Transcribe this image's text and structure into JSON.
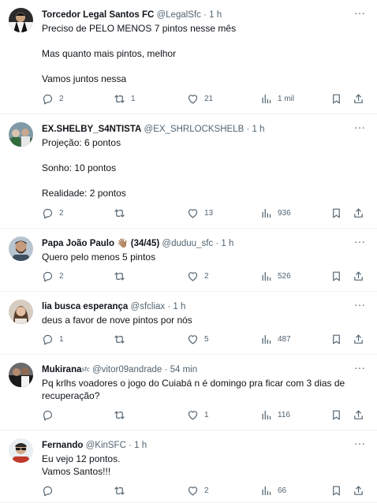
{
  "tweets": [
    {
      "name": "Torcedor Legal Santos FC",
      "handle": "@LegalSfc",
      "time": "1 h",
      "lines": [
        "Preciso de PELO MENOS 7 pintos nesse mês",
        "",
        "Mas quanto mais pintos, melhor",
        "",
        "Vamos juntos nessa"
      ],
      "replies": "2",
      "retweets": "1",
      "likes": "21",
      "views": "1 mil"
    },
    {
      "name": "EX.SHELBY_S4NTISTA",
      "handle": "@EX_SHRLOCKSHELB",
      "time": "1 h",
      "lines": [
        "Projeção: 6 pontos",
        "",
        "Sonho: 10 pontos",
        "",
        "Realidade: 2 pontos"
      ],
      "replies": "2",
      "retweets": "",
      "likes": "13",
      "views": "936"
    },
    {
      "name": "Papa João Paulo 👋🏽 (34/45)",
      "handle": "@duduu_sfc",
      "time": "1 h",
      "lines": [
        "Quero pelo menos 5 pintos"
      ],
      "replies": "2",
      "retweets": "",
      "likes": "2",
      "views": "526"
    },
    {
      "name": "lia busca esperança",
      "handle": "@sfcliax",
      "time": "1 h",
      "lines": [
        "deus a favor de nove pintos por nós"
      ],
      "replies": "1",
      "retweets": "",
      "likes": "5",
      "views": "487"
    },
    {
      "name": "Mukirana",
      "badge": "sfc",
      "handle": "@vitor09andrade",
      "time": "54 min",
      "lines": [
        "Pq krlhs voadores o jogo do Cuiabá n é domingo pra ficar com 3 dias de",
        "recuperação?"
      ],
      "replies": "",
      "retweets": "",
      "likes": "1",
      "views": "116"
    },
    {
      "name": "Fernando",
      "handle": "@KinSFC",
      "time": "1 h",
      "lines": [
        "Eu vejo 12 pontos.",
        "Vamos Santos!!!"
      ],
      "replies": "",
      "retweets": "",
      "likes": "2",
      "views": "66"
    }
  ],
  "separator": "·",
  "more_glyph": "···",
  "icons": {
    "reply": "reply-icon",
    "retweet": "retweet-icon",
    "like": "heart-icon",
    "views": "views-icon",
    "bookmark": "bookmark-icon",
    "share": "share-icon",
    "more": "more-icon"
  },
  "colors": {
    "text": "#0f1419",
    "muted": "#536471",
    "divider": "#eff3f4"
  }
}
